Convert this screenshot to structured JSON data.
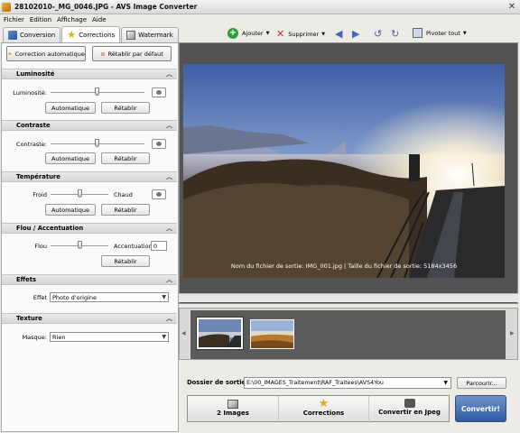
{
  "window": {
    "title": "28102010-_MG_0046.JPG - AVS Image Converter"
  },
  "menu": [
    "Fichier",
    "Edition",
    "Affichage",
    "Aide"
  ],
  "tabs": [
    {
      "label": "Conversion",
      "icon": "conversion-icon"
    },
    {
      "label": "Corrections",
      "icon": "star-icon"
    },
    {
      "label": "Watermark",
      "icon": "watermark-icon"
    }
  ],
  "panel_buttons": {
    "auto": "Correction automatique",
    "reset": "Rétablir par défaut"
  },
  "sections": {
    "luminosite": {
      "title": "Luminosité",
      "label": "Luminosité:",
      "auto": "Automatique",
      "reset": "Rétablir"
    },
    "contraste": {
      "title": "Contraste",
      "label": "Contraste:",
      "auto": "Automatique",
      "reset": "Rétablir"
    },
    "temperature": {
      "title": "Température",
      "left": "Froid",
      "right": "Chaud",
      "auto": "Automatique",
      "reset": "Rétablir"
    },
    "flou": {
      "title": "Flou / Accentuation",
      "left": "Flou",
      "right": "Accentuation",
      "value": "0",
      "reset": "Rétablir"
    },
    "effets": {
      "title": "Effets",
      "label": "Effet",
      "value": "Photo d'origine"
    },
    "texture": {
      "title": "Texture",
      "label": "Masque:",
      "value": "Rien"
    }
  },
  "toolbar": {
    "add": "Ajouter",
    "delete": "Supprimer",
    "rotate_all": "Pivoter tout"
  },
  "preview": {
    "caption": "Nom du fichier de sortie: IMG_001.jpg | Taille du fichier de sortie: 5184x3456"
  },
  "output": {
    "label": "Dossier de sortie:",
    "path": "E:\\00_IMAGES_Traitement\\RAF_Traitees\\AVS4You",
    "browse": "Parcourir..."
  },
  "steps": [
    "2 Images",
    "Corrections",
    "Convertir en Jpeg"
  ],
  "convert": "Convertir!"
}
